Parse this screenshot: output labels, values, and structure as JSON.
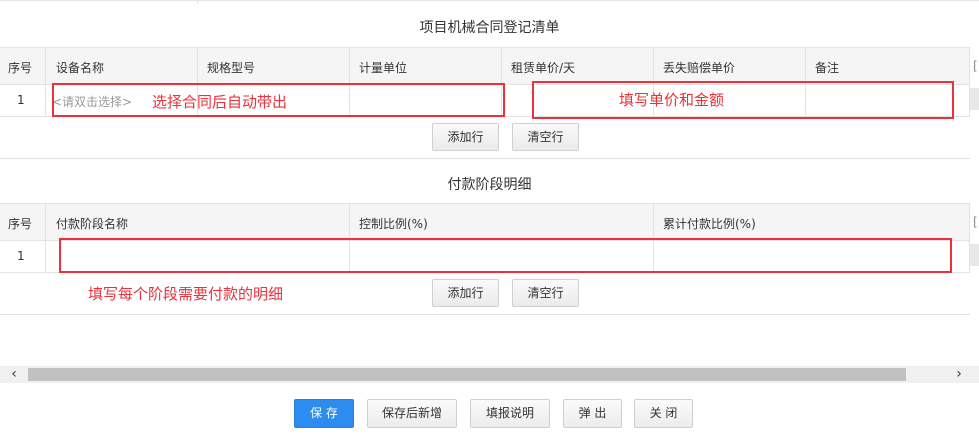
{
  "section1": {
    "title": "项目机械合同登记清单",
    "headers": [
      "序号",
      "设备名称",
      "规格型号",
      "计量单位",
      "租赁单价/天",
      "丢失赔偿单价",
      "备注"
    ],
    "row": {
      "index": "1",
      "device_placeholder": "<请双击选择>"
    },
    "add_row": "添加行",
    "clear_row": "清空行",
    "annotation_left": "选择合同后自动带出",
    "annotation_right": "填写单价和金额"
  },
  "section2": {
    "title": "付款阶段明细",
    "headers": [
      "序号",
      "付款阶段名称",
      "控制比例(%)",
      "累计付款比例(%)"
    ],
    "row": {
      "index": "1"
    },
    "add_row": "添加行",
    "clear_row": "清空行",
    "annotation": "填写每个阶段需要付款的明细"
  },
  "scrollbar": {
    "left_arrow": "‹",
    "right_arrow": "›"
  },
  "footer": {
    "save": "保 存",
    "save_new": "保存后新增",
    "instructions": "填报说明",
    "popup": "弹 出",
    "close": "关 闭"
  },
  "colors": {
    "annotation": "#e8323c",
    "primary": "#2d8cf0"
  }
}
